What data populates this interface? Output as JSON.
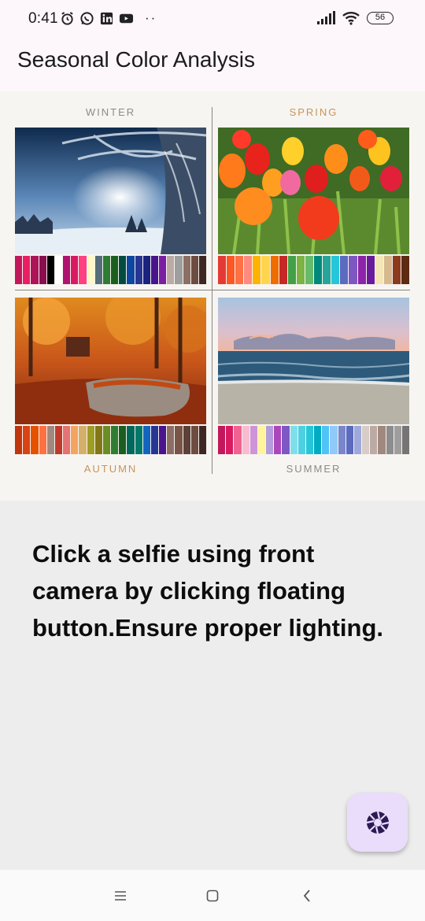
{
  "status_bar": {
    "time": "0:41",
    "battery": "56",
    "icons": [
      "alarm-icon",
      "whatsapp-icon",
      "linkedin-icon",
      "youtube-icon",
      "more-dots-icon",
      "signal-icon",
      "wifi-icon",
      "battery-icon"
    ],
    "dots": "··"
  },
  "app_bar": {
    "title": "Seasonal Color Analysis"
  },
  "seasons": {
    "winter": {
      "label": "WINTER",
      "label_color": "#8f8b86",
      "palette": [
        "#c2185b",
        "#e91e63",
        "#ad1457",
        "#880e4f",
        "#000000",
        "#ffffff",
        "#b0126f",
        "#d81b60",
        "#ff4081",
        "#fff8c4",
        "#546e7a",
        "#2e7d32",
        "#1b5e20",
        "#004d40",
        "#0d47a1",
        "#283593",
        "#1a237e",
        "#4a148c",
        "#7b1fa2",
        "#bcaaa4",
        "#9e9e9e",
        "#8d6e63",
        "#6d4c41",
        "#3e2723"
      ]
    },
    "spring": {
      "label": "SPRING",
      "label_color": "#c8945a",
      "palette": [
        "#e53935",
        "#ff5722",
        "#ff7043",
        "#ff8a80",
        "#ffb300",
        "#ffd54f",
        "#ef6c00",
        "#c62828",
        "#43a047",
        "#7cb342",
        "#66bb6a",
        "#00897b",
        "#26a69a",
        "#26c6da",
        "#5c6bc0",
        "#7e57c2",
        "#8e24aa",
        "#6a1b9a",
        "#f5e6b8",
        "#d7b98e",
        "#8d3b1f",
        "#5d2a14"
      ]
    },
    "autumn": {
      "label": "AUTUMN",
      "label_color": "#c8945a",
      "palette": [
        "#bf360c",
        "#d84315",
        "#e65100",
        "#ff7043",
        "#a1887f",
        "#c0392b",
        "#e57373",
        "#f4a460",
        "#d4b06a",
        "#9e9d24",
        "#827717",
        "#6b8e23",
        "#2e7d32",
        "#1b5e20",
        "#00695c",
        "#00796b",
        "#1565c0",
        "#283593",
        "#4a148c",
        "#8d6e63",
        "#795548",
        "#5d4037",
        "#6d4c41",
        "#3e2723"
      ]
    },
    "summer": {
      "label": "SUMMER",
      "label_color": "#8f8b86",
      "palette": [
        "#c2185b",
        "#d81b60",
        "#f06292",
        "#f8bbd0",
        "#ce93d8",
        "#fff59d",
        "#b39ddb",
        "#ab47bc",
        "#7e57c2",
        "#80deea",
        "#4dd0e1",
        "#26c6da",
        "#00acc1",
        "#4fc3f7",
        "#90caf9",
        "#7986cb",
        "#5c6bc0",
        "#9fa8da",
        "#d7ccc8",
        "#bcaaa4",
        "#a1887f",
        "#8d8d8d",
        "#9e9e9e",
        "#757575"
      ]
    }
  },
  "instruction": "Click a selfie using front camera by clicking floating button.Ensure proper lighting.",
  "fab": {
    "icon": "camera-shutter-icon",
    "color": "#e9ddfb"
  },
  "nav_bar": {
    "icons": [
      "menu-icon",
      "home-icon",
      "back-icon"
    ]
  }
}
